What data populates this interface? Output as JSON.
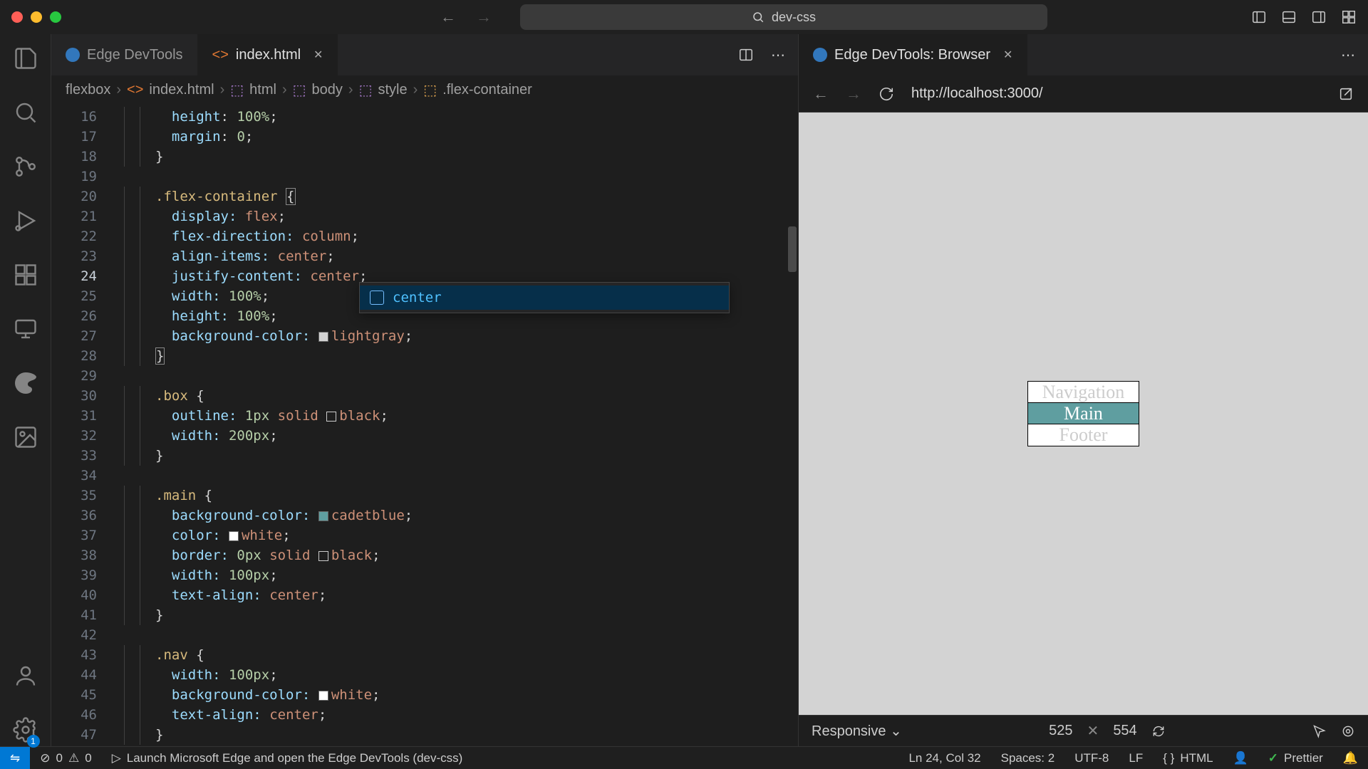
{
  "titlebar": {
    "search_text": "dev-css"
  },
  "tabs": {
    "devtools": "Edge DevTools",
    "file": "index.html",
    "browser": "Edge DevTools: Browser"
  },
  "breadcrumbs": {
    "c0": "flexbox",
    "c1": "index.html",
    "c2": "html",
    "c3": "body",
    "c4": "style",
    "c5": ".flex-container"
  },
  "autocomplete": {
    "item0": "center"
  },
  "browser": {
    "url": "http://localhost:3000/",
    "nav": "Navigation",
    "main": "Main",
    "footer": "Footer",
    "resp": "Responsive",
    "w": "525",
    "h": "554"
  },
  "status": {
    "errors": "0",
    "warnings": "0",
    "launch": "Launch Microsoft Edge and open the Edge DevTools (dev-css)",
    "pos": "Ln 24, Col 32",
    "spaces": "Spaces: 2",
    "enc": "UTF-8",
    "eol": "LF",
    "lang": "HTML",
    "prettier": "Prettier"
  },
  "code": {
    "l16": "height: 100%;",
    "l17": "margin: 0;",
    "l18": "}",
    "l19": "",
    "l20_sel": ".flex-container",
    "l21_p": "display:",
    "l21_v": "flex",
    "l22_p": "flex-direction:",
    "l22_v": "column",
    "l23_p": "align-items:",
    "l23_v": "center",
    "l24_p": "justify-content:",
    "l24_v": "center",
    "l25_p": "width:",
    "l25_v": "100%",
    "l26_p": "height:",
    "l26_v": "100%",
    "l27_p": "background-color:",
    "l27_v": "lightgray",
    "l30_sel": ".box",
    "l31_p": "outline:",
    "l31_v1": "1px",
    "l31_v2": "solid",
    "l31_v3": "black",
    "l32_p": "width:",
    "l32_v": "200px",
    "l35_sel": ".main",
    "l36_p": "background-color:",
    "l36_v": "cadetblue",
    "l37_p": "color:",
    "l37_v": "white",
    "l38_p": "border:",
    "l38_v1": "0px",
    "l38_v2": "solid",
    "l38_v3": "black",
    "l39_p": "width:",
    "l39_v": "100px",
    "l40_p": "text-align:",
    "l40_v": "center",
    "l43_sel": ".nav",
    "l44_p": "width:",
    "l44_v": "100px",
    "l45_p": "background-color:",
    "l45_v": "white",
    "l46_p": "text-align:",
    "l46_v": "center"
  }
}
